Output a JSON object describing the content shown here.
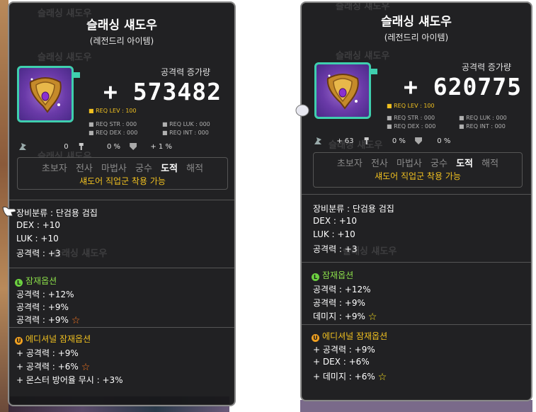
{
  "left": {
    "title": "슬래싱 섀도우",
    "grade": "(레전드리 아이템)",
    "atk_label": "공격력 증가량",
    "atk_value": "+ 573482",
    "req_lev": "REQ LEV : 100",
    "req_str": "REQ STR : 000",
    "req_luk": "REQ LUK : 000",
    "req_dex": "REQ DEX : 000",
    "req_int": "REQ INT : 000",
    "stat_a": "0",
    "stat_b": "0 %",
    "stat_c": "+ 1 %",
    "jobs": [
      "초보자",
      "전사",
      "마법사",
      "궁수",
      "도적",
      "해적"
    ],
    "job_note": "섀도어 직업군 착용 가능",
    "category": "장비분류 : 단검용 검집",
    "dex": "DEX : +10",
    "luk": "LUK : +10",
    "atk": "공격력 : +3",
    "potential_title": "잠재옵션",
    "potential": [
      "공격력 : +12%",
      "공격력 : +9%",
      "공격력 : +9%"
    ],
    "additional_title": "에디셔널 잠재옵션",
    "additional": [
      "+ 공격력 : +9%",
      "+ 공격력 : +6%",
      "+ 몬스터 방어율 무시 : +3%"
    ]
  },
  "right": {
    "title": "슬래싱 섀도우",
    "grade": "(레전드리 아이템)",
    "atk_label": "공격력 증가량",
    "atk_value": "+ 620775",
    "req_lev": "REQ LEV : 100",
    "req_str": "REQ STR : 000",
    "req_luk": "REQ LUK : 000",
    "req_dex": "REQ DEX : 000",
    "req_int": "REQ INT : 000",
    "stat_a": "+ 63",
    "stat_b": "0 %",
    "stat_c": "0 %",
    "jobs": [
      "초보자",
      "전사",
      "마법사",
      "궁수",
      "도적",
      "해적"
    ],
    "job_note": "섀도어 직업군 착용 가능",
    "category": "장비분류 : 단검용 검집",
    "dex": "DEX : +10",
    "luk": "LUK : +10",
    "atk": "공격력 : +3",
    "potential_title": "잠재옵션",
    "potential": [
      "공격력 : +12%",
      "공격력 : +9%",
      "데미지 : +9%"
    ],
    "additional_title": "에디셔널 잠재옵션",
    "additional": [
      "+ 공격력 : +9%",
      "+ DEX : +6%",
      "+ 데미지 : +6%"
    ]
  },
  "ghost_text": "슬래싱 섀도우",
  "badges": {
    "potential": "L",
    "additional": "U"
  },
  "colors": {
    "frame": "#3fcfae",
    "potential": "#8ce04a",
    "additional": "#f0c020",
    "star_orange": "#ff7a20",
    "star_yellow": "#f8e020"
  }
}
